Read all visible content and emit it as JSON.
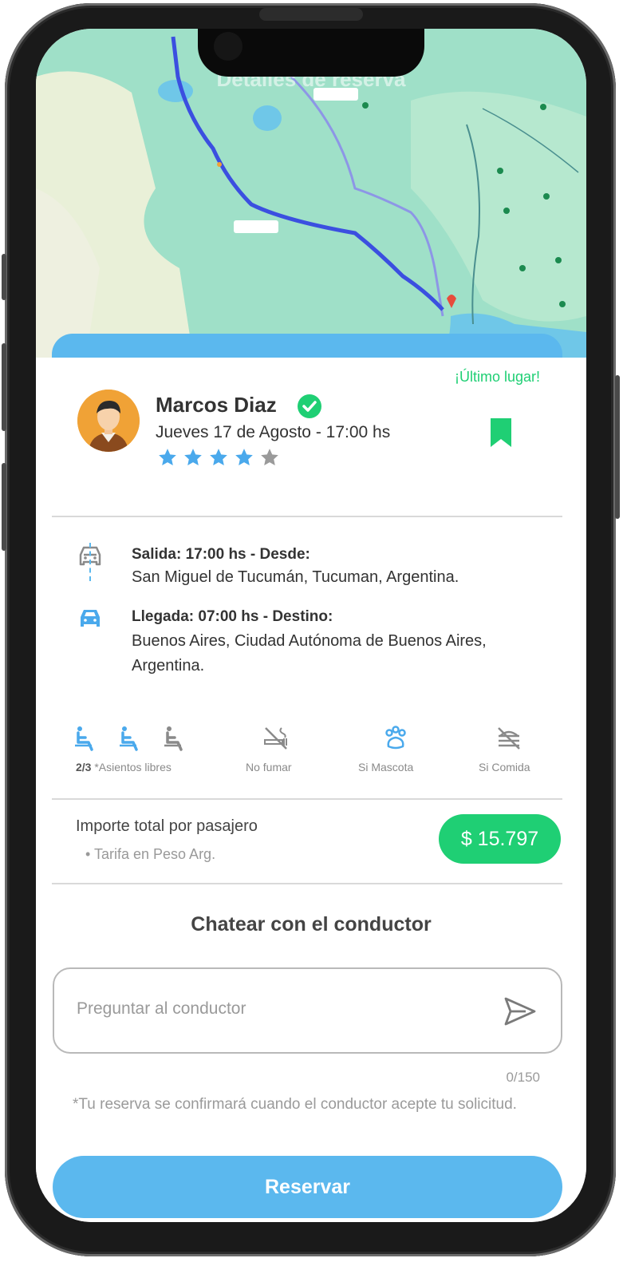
{
  "map": {
    "header_title": "Detalles de reserva"
  },
  "driver": {
    "badge": "¡Último lugar!",
    "name": "Marcos Diaz",
    "date_time": "Jueves 17 de Agosto - 17:00 hs",
    "rating": 4,
    "rating_max": 5,
    "avatar_icon": "avatar-man-icon",
    "verified_icon": "check-circle-icon",
    "bookmark_icon": "bookmark-icon"
  },
  "route": {
    "departure_label": "Salida: 17:00 hs - Desde:",
    "departure_place": "San Miguel de Tucumán, Tucuman, Argentina.",
    "arrival_label": "Llegada: 07:00 hs - Destino:",
    "arrival_place": "Buenos Aires, Ciudad Autónoma de Buenos Aires, Argentina."
  },
  "features": {
    "seats_count": "2/3",
    "seats_label": "*Asientos libres",
    "smoking": "No fumar",
    "pets": "Si Mascota",
    "food": "Si Comida"
  },
  "price": {
    "label": "Importe total por pasajero",
    "currency_note": "Tarifa en Peso  Arg.",
    "amount": "$ 15.797"
  },
  "chat": {
    "title": "Chatear con el conductor",
    "placeholder": "Preguntar al conductor",
    "counter": "0/150",
    "note": "*Tu reserva se confirmará cuando el conductor acepte tu solicitud."
  },
  "actions": {
    "reserve_label": "Reservar"
  },
  "colors": {
    "accent_blue": "#5bb8ee",
    "accent_green": "#1fcf74",
    "map_water": "#9fe0c8"
  }
}
